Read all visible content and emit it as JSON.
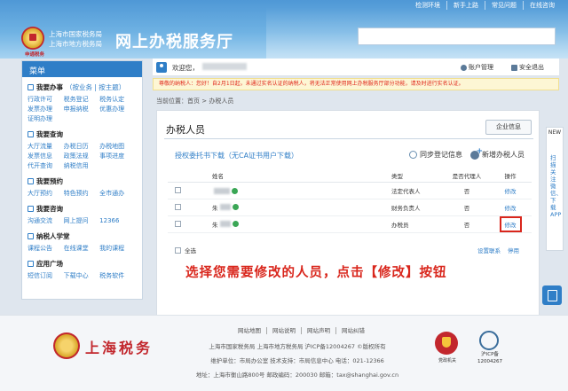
{
  "header": {
    "top_links": [
      "检测环境",
      "新手上路",
      "常见问题",
      "在线咨询"
    ],
    "org_line1": "上海市国家税务局",
    "org_line2": "上海市地方税务局",
    "site_title": "网上办税服务厅",
    "logo_sub": "申通税务"
  },
  "sidebar": {
    "menu_title": "菜单",
    "groups": [
      {
        "title": "我要办事",
        "subtitle": "（按业务 | 按主题）",
        "links": [
          "行政许可",
          "税务登记",
          "税务认定",
          "发票办理",
          "申报纳税",
          "优惠办理",
          "证明办理"
        ]
      },
      {
        "title": "我要查询",
        "subtitle": "",
        "links": [
          "大厅流量",
          "办税日历",
          "办税地图",
          "发票信息",
          "政策法规",
          "事项进度",
          "代开查询",
          "纳税信用"
        ]
      },
      {
        "title": "我要预约",
        "subtitle": "",
        "links": [
          "大厅预约",
          "特色预约",
          "全市通办"
        ]
      },
      {
        "title": "我要咨询",
        "subtitle": "",
        "links": [
          "沟通交流",
          "网上提问",
          "12366"
        ]
      },
      {
        "title": "纳税人学堂",
        "subtitle": "",
        "links": [
          "课程公告",
          "在线课堂",
          "我的课程"
        ]
      },
      {
        "title": "应用广场",
        "subtitle": "",
        "links": [
          "短信订阅",
          "下载中心",
          "税务软件"
        ]
      }
    ]
  },
  "topbar": {
    "welcome": "欢迎您，",
    "account_label": "账户管理",
    "security_label": "安全退出"
  },
  "notice": "尊敬的纳税人：您好！自2月1日起，未通过实名认证的纳税人，将无法正常使用网上办税服务厅部分功能，请及时进行实名认证。",
  "breadcrumb": "当前位置：首页 > 办税人员",
  "panel": {
    "title": "办税人员",
    "corp_info_button": "企业信息",
    "download_link": "授权委托书下载（无CA证书用户下载）",
    "sync_label": "同步登记信息",
    "add_label": "新增办税人员",
    "columns": [
      "姓名",
      "类型",
      "是否代理人",
      "操作"
    ],
    "rows": [
      {
        "name": "",
        "type": "法定代表人",
        "agent": "否",
        "op": "修改"
      },
      {
        "name": "朱",
        "type": "财务负责人",
        "agent": "否",
        "op": "修改"
      },
      {
        "name": "朱",
        "type": "办税员",
        "agent": "否",
        "op": "修改"
      }
    ],
    "select_all": "全选",
    "set_contact": "设置联系",
    "disable": "停用"
  },
  "caption": "选择您需要修改的人员，点击【修改】按钮",
  "float": {
    "new_badge": "NEW",
    "qr_text": "扫描关注微信、下载APP"
  },
  "footer": {
    "brand": "上海税务",
    "links": [
      "网站地图",
      "网站说明",
      "网站声明",
      "网站纠错"
    ],
    "line1": "上海市国家税务局  上海市地方税务局  沪ICP备12004267 ©版权所有",
    "line2": "维护单位：市局办公室  技术支持：市局信息中心  电话：021-12366",
    "line3": "地址：上海市衡山路800号  邮政编码：200030  邮箱：tax@shanghai.gov.cn",
    "badge1": "党政机关",
    "badge2_line1": "沪ICP备",
    "badge2_line2": "12004267"
  }
}
